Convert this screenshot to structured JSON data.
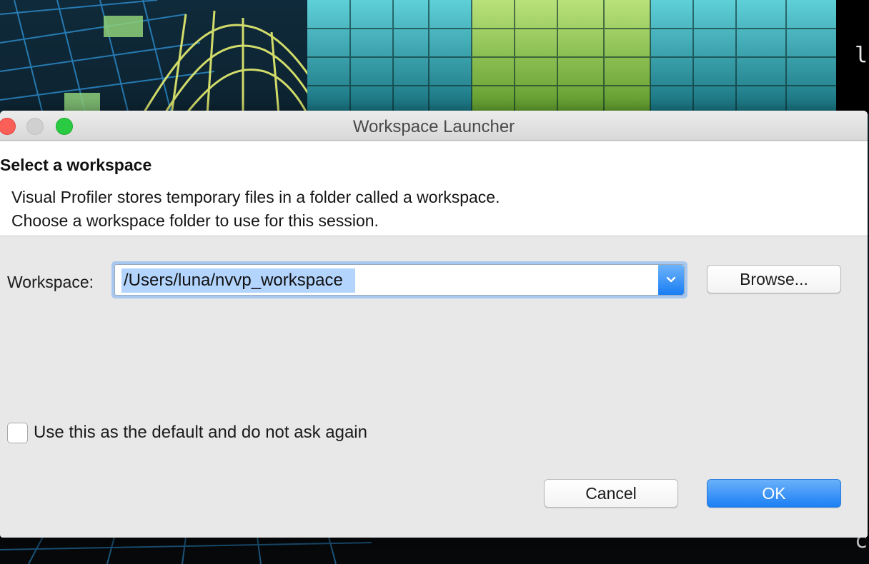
{
  "background": {
    "terminal_fragment_top": "ls",
    "terminal_fragment_bottom": "c"
  },
  "window": {
    "title": "Workspace Launcher"
  },
  "header": {
    "title": "Select a workspace",
    "description_line1": "Visual Profiler stores temporary files in a folder called a workspace.",
    "description_line2": "Choose a workspace folder to use for this session."
  },
  "workspace": {
    "label": "Workspace:",
    "value": "/Users/luna/nvvp_workspace",
    "browse_label": "Browse..."
  },
  "checkbox": {
    "label": "Use this as the default and do not ask again",
    "checked": false
  },
  "buttons": {
    "cancel_label": "Cancel",
    "ok_label": "OK"
  },
  "colors": {
    "accent": "#1c7ff5",
    "close": "#fc5f57",
    "minimize": "#d0d0d0",
    "zoom": "#2acb42",
    "selection": "#b3d4fd"
  },
  "icons": {
    "dropdown": "chevron-down-icon"
  }
}
